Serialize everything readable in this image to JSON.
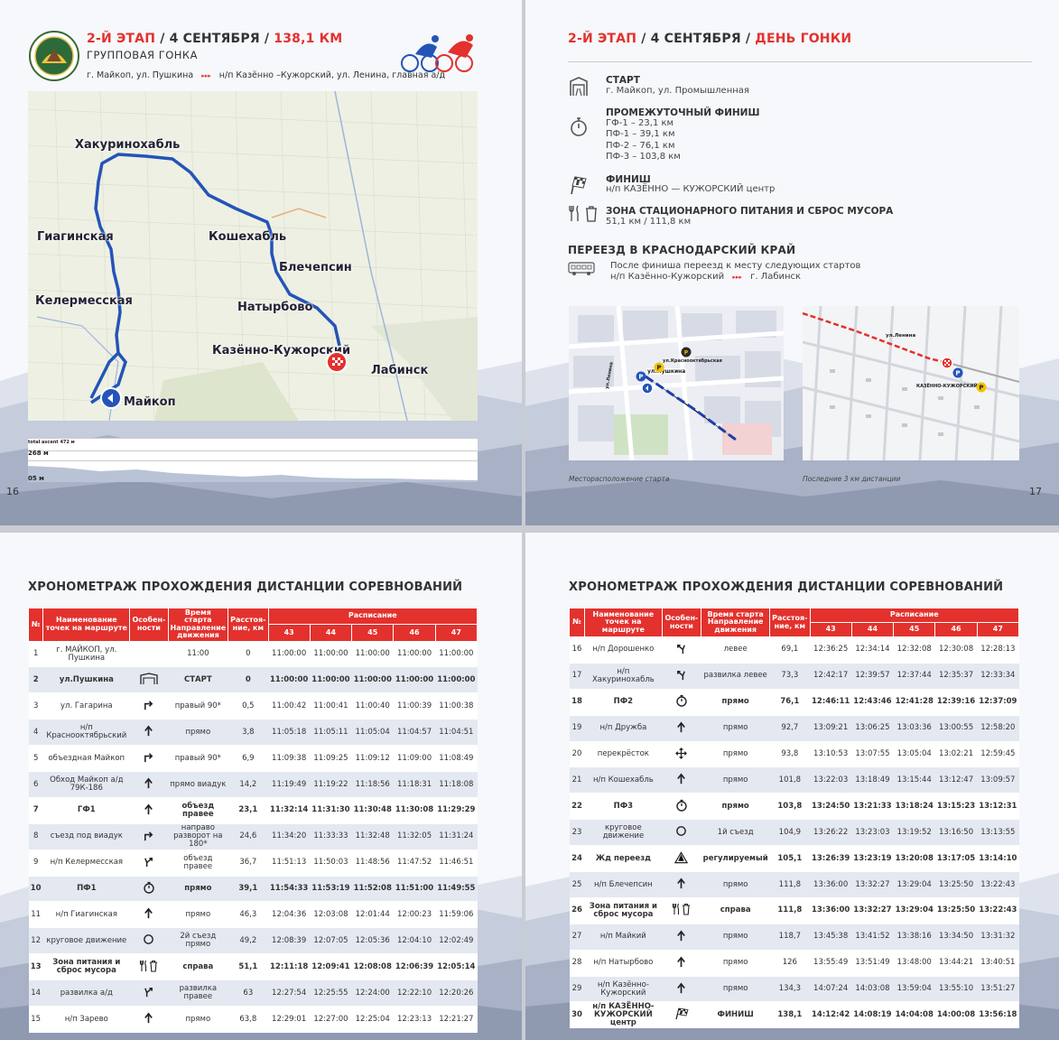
{
  "p16": {
    "page_number": "16",
    "stage_no": "2-Й ЭТАП",
    "date": "4 СЕНТЯБРЯ",
    "distance": "138,1 КМ",
    "race_type": "ГРУППОВАЯ ГОНКА",
    "route_from": "г. Майкоп, ул. Пушкина",
    "route_arrow": "▸▸▸",
    "route_to": "н/п Казённо –Кужорский, ул. Ленина, главная а/д",
    "map_places": [
      "Хакуринохабль",
      "Гиагинская",
      "Кошехабль",
      "Блечепсин",
      "Келермесская",
      "Натырбово",
      "Казённо-Кужорский",
      "Лабинск",
      "Майкоп"
    ],
    "profile": {
      "total_ascent": "total ascent 472 м",
      "max": "268 м",
      "min": "05 м"
    }
  },
  "p17": {
    "page_number": "17",
    "stage_no": "2-Й ЭТАП",
    "date": "4 СЕНТЯБРЯ",
    "day": "ДЕНЬ ГОНКИ",
    "start_title": "СТАРТ",
    "start_text": "г. Майкоп, ул. Промышленная",
    "inter_title": "ПРОМЕЖУТОЧНЫЙ ФИНИШ",
    "inter_lines": [
      "ГФ-1 –  23,1 км",
      "ПФ-1 –  39,1 км",
      "ПФ-2 –  76,1 км",
      "ПФ-3 –  103,8 км"
    ],
    "finish_title": "ФИНИШ",
    "finish_text": "н/п КАЗЁННО — КУЖОРСКИЙ центр",
    "feed_title": "ЗОНА СТАЦИОНАРНОГО ПИТАНИЯ И СБРОС МУСОРА",
    "feed_text": "51,1  км / 111,8  км",
    "transfer_title": "ПЕРЕЕЗД В КРАСНОДАРСКИЙ КРАЙ",
    "transfer_line1": "После финиша переезд к месту следующих стартов",
    "transfer_from": "н/п Казённо-Кужорский",
    "transfer_arrow": "▸▸▸",
    "transfer_to": "г. Лабинск",
    "map1_caption": "Месторасположение старта",
    "map2_caption": "Последние 3 км дистанции",
    "map1_labels": [
      "ул.Пушкина",
      "ул.Краснооктябрьская",
      "ул.Ленина"
    ],
    "map2_labels": [
      "ул.Ленина",
      "КАЗЁННО-КУЖОРСКИЙ"
    ]
  },
  "table_title": "ХРОНОМЕТРАЖ ПРОХОЖДЕНИЯ ДИСТАНЦИИ СОРЕВНОВАНИЙ",
  "headers": {
    "num": "№",
    "name": "Наименование точек на маршруте",
    "feat": "Особен-ности",
    "start": "Время старта Направление движения",
    "dist": "Расстоя-ние, км",
    "sched": "Расписание",
    "speeds": [
      "43",
      "44",
      "45",
      "46",
      "47"
    ]
  },
  "rows_left": [
    {
      "n": "1",
      "name": "г. МАЙКОП, ул. Пушкина",
      "icon": "",
      "dir": "11:00",
      "km": "0",
      "t": [
        "11:00:00",
        "11:00:00",
        "11:00:00",
        "11:00:00",
        "11:00:00"
      ]
    },
    {
      "n": "2",
      "name": "ул.Пушкина",
      "icon": "gate",
      "dir": "СТАРТ",
      "km": "0",
      "t": [
        "11:00:00",
        "11:00:00",
        "11:00:00",
        "11:00:00",
        "11:00:00"
      ],
      "b": true
    },
    {
      "n": "3",
      "name": "ул. Гагарина",
      "icon": "right",
      "dir": "правый 90*",
      "km": "0,5",
      "t": [
        "11:00:42",
        "11:00:41",
        "11:00:40",
        "11:00:39",
        "11:00:38"
      ]
    },
    {
      "n": "4",
      "name": "н/п Краснооктябрьский",
      "icon": "up",
      "dir": "прямо",
      "km": "3,8",
      "t": [
        "11:05:18",
        "11:05:11",
        "11:05:04",
        "11:04:57",
        "11:04:51"
      ]
    },
    {
      "n": "5",
      "name": "объездная Майкоп",
      "icon": "right",
      "dir": "правый 90*",
      "km": "6,9",
      "t": [
        "11:09:38",
        "11:09:25",
        "11:09:12",
        "11:09:00",
        "11:08:49"
      ]
    },
    {
      "n": "6",
      "name": "Обход Майкоп а/д 79К-186",
      "icon": "up",
      "dir": "прямо виадук",
      "km": "14,2",
      "t": [
        "11:19:49",
        "11:19:22",
        "11:18:56",
        "11:18:31",
        "11:18:08"
      ]
    },
    {
      "n": "7",
      "name": "ГФ1",
      "icon": "up",
      "dir": "объезд правее",
      "km": "23,1",
      "t": [
        "11:32:14",
        "11:31:30",
        "11:30:48",
        "11:30:08",
        "11:29:29"
      ],
      "b": true
    },
    {
      "n": "8",
      "name": "съезд под виадук",
      "icon": "right",
      "dir": "направо разворот на 180*",
      "km": "24,6",
      "t": [
        "11:34:20",
        "11:33:33",
        "11:32:48",
        "11:32:05",
        "11:31:24"
      ]
    },
    {
      "n": "9",
      "name": "н/п Келермесская",
      "icon": "forkr",
      "dir": "объезд правее",
      "km": "36,7",
      "t": [
        "11:51:13",
        "11:50:03",
        "11:48:56",
        "11:47:52",
        "11:46:51"
      ]
    },
    {
      "n": "10",
      "name": "ПФ1",
      "icon": "watch",
      "dir": "прямо",
      "km": "39,1",
      "t": [
        "11:54:33",
        "11:53:19",
        "11:52:08",
        "11:51:00",
        "11:49:55"
      ],
      "b": true
    },
    {
      "n": "11",
      "name": "н/п Гиагинская",
      "icon": "up",
      "dir": "прямо",
      "km": "46,3",
      "t": [
        "12:04:36",
        "12:03:08",
        "12:01:44",
        "12:00:23",
        "11:59:06"
      ]
    },
    {
      "n": "12",
      "name": "круговое движение",
      "icon": "ring",
      "dir": "2й съезд прямо",
      "km": "49,2",
      "t": [
        "12:08:39",
        "12:07:05",
        "12:05:36",
        "12:04:10",
        "12:02:49"
      ]
    },
    {
      "n": "13",
      "name": "Зона питания и сброс мусора",
      "icon": "food",
      "dir": "справа",
      "km": "51,1",
      "t": [
        "12:11:18",
        "12:09:41",
        "12:08:08",
        "12:06:39",
        "12:05:14"
      ],
      "b": true
    },
    {
      "n": "14",
      "name": "развилка а/д",
      "icon": "forkr",
      "dir": "развилка правее",
      "km": "63",
      "t": [
        "12:27:54",
        "12:25:55",
        "12:24:00",
        "12:22:10",
        "12:20:26"
      ]
    },
    {
      "n": "15",
      "name": "н/п Зарево",
      "icon": "up",
      "dir": "прямо",
      "km": "63,8",
      "t": [
        "12:29:01",
        "12:27:00",
        "12:25:04",
        "12:23:13",
        "12:21:27"
      ]
    }
  ],
  "rows_right": [
    {
      "n": "16",
      "name": "н/п Дорошенко",
      "icon": "forkl",
      "dir": "левее",
      "km": "69,1",
      "t": [
        "12:36:25",
        "12:34:14",
        "12:32:08",
        "12:30:08",
        "12:28:13"
      ]
    },
    {
      "n": "17",
      "name": "н/п Хакуринохабль",
      "icon": "forkl",
      "dir": "развилка левее",
      "km": "73,3",
      "t": [
        "12:42:17",
        "12:39:57",
        "12:37:44",
        "12:35:37",
        "12:33:34"
      ]
    },
    {
      "n": "18",
      "name": "ПФ2",
      "icon": "watch",
      "dir": "прямо",
      "km": "76,1",
      "t": [
        "12:46:11",
        "12:43:46",
        "12:41:28",
        "12:39:16",
        "12:37:09"
      ],
      "b": true
    },
    {
      "n": "19",
      "name": "н/п Дружба",
      "icon": "up",
      "dir": "прямо",
      "km": "92,7",
      "t": [
        "13:09:21",
        "13:06:25",
        "13:03:36",
        "13:00:55",
        "12:58:20"
      ]
    },
    {
      "n": "20",
      "name": "перекрёсток",
      "icon": "cross",
      "dir": "прямо",
      "km": "93,8",
      "t": [
        "13:10:53",
        "13:07:55",
        "13:05:04",
        "13:02:21",
        "12:59:45"
      ]
    },
    {
      "n": "21",
      "name": "н/п Кошехабль",
      "icon": "up",
      "dir": "прямо",
      "km": "101,8",
      "t": [
        "13:22:03",
        "13:18:49",
        "13:15:44",
        "13:12:47",
        "13:09:57"
      ]
    },
    {
      "n": "22",
      "name": "ПФ3",
      "icon": "watch",
      "dir": "прямо",
      "km": "103,8",
      "t": [
        "13:24:50",
        "13:21:33",
        "13:18:24",
        "13:15:23",
        "13:12:31"
      ],
      "b": true
    },
    {
      "n": "23",
      "name": "круговое движение",
      "icon": "ring",
      "dir": "1й съезд",
      "km": "104,9",
      "t": [
        "13:26:22",
        "13:23:03",
        "13:19:52",
        "13:16:50",
        "13:13:55"
      ]
    },
    {
      "n": "24",
      "name": "Жд переезд",
      "icon": "rail",
      "dir": "регулируемый",
      "km": "105,1",
      "t": [
        "13:26:39",
        "13:23:19",
        "13:20:08",
        "13:17:05",
        "13:14:10"
      ],
      "b": true
    },
    {
      "n": "25",
      "name": "н/п Блечепсин",
      "icon": "up",
      "dir": "прямо",
      "km": "111,8",
      "t": [
        "13:36:00",
        "13:32:27",
        "13:29:04",
        "13:25:50",
        "13:22:43"
      ]
    },
    {
      "n": "26",
      "name": "Зона питания и сброс мусора",
      "icon": "food",
      "dir": "справа",
      "km": "111,8",
      "t": [
        "13:36:00",
        "13:32:27",
        "13:29:04",
        "13:25:50",
        "13:22:43"
      ],
      "b": true
    },
    {
      "n": "27",
      "name": "н/п Майкий",
      "icon": "up",
      "dir": "прямо",
      "km": "118,7",
      "t": [
        "13:45:38",
        "13:41:52",
        "13:38:16",
        "13:34:50",
        "13:31:32"
      ]
    },
    {
      "n": "28",
      "name": "н/п Натырбово",
      "icon": "up",
      "dir": "прямо",
      "km": "126",
      "t": [
        "13:55:49",
        "13:51:49",
        "13:48:00",
        "13:44:21",
        "13:40:51"
      ]
    },
    {
      "n": "29",
      "name": "н/п Казённо-Кужорский",
      "icon": "up",
      "dir": "прямо",
      "km": "134,3",
      "t": [
        "14:07:24",
        "14:03:08",
        "13:59:04",
        "13:55:10",
        "13:51:27"
      ]
    },
    {
      "n": "30",
      "name": "н/п КАЗЁННО-КУЖОРСКИЙ центр",
      "icon": "flag",
      "dir": "ФИНИШ",
      "km": "138,1",
      "t": [
        "14:12:42",
        "14:08:19",
        "14:04:08",
        "14:00:08",
        "13:56:18"
      ],
      "b": true
    }
  ],
  "colors": {
    "accent": "#e3312d",
    "route": "#2454b8",
    "table_even": "#e4e8f1"
  }
}
